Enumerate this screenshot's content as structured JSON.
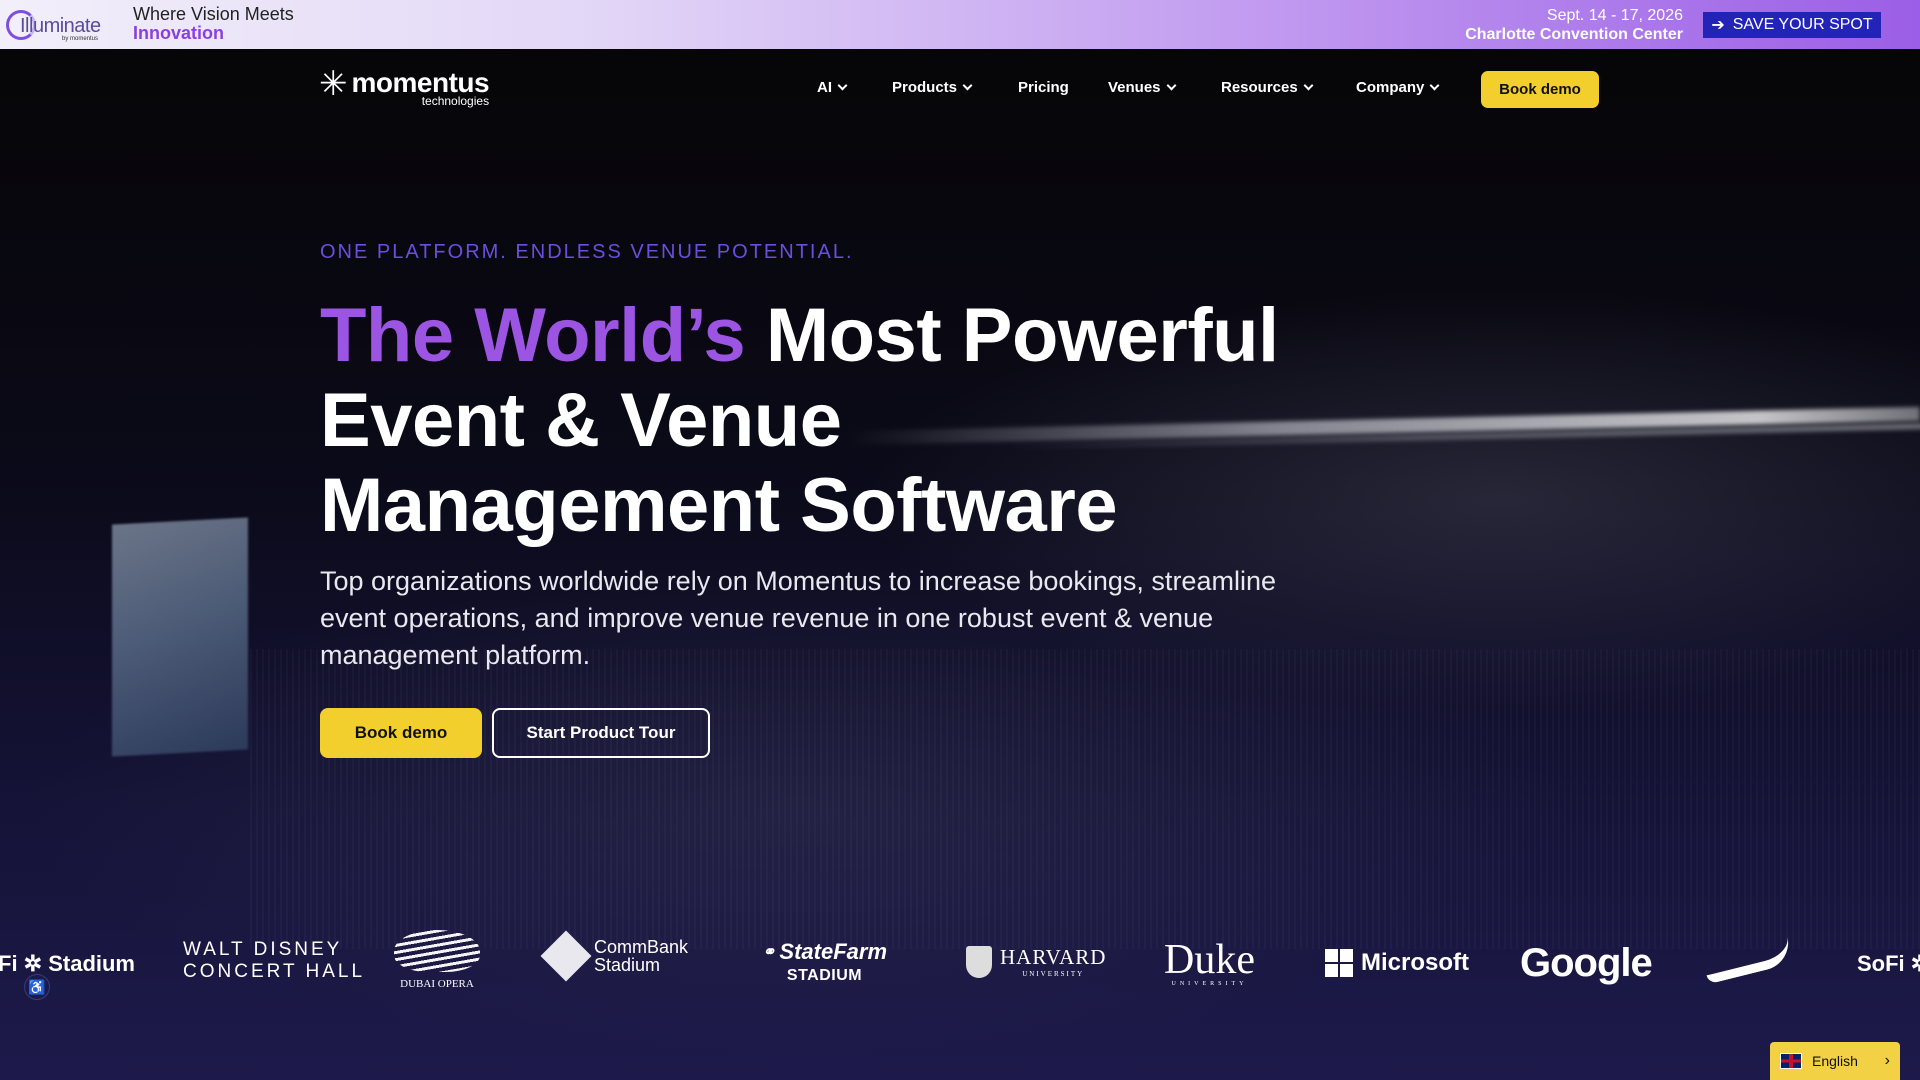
{
  "banner": {
    "logo_word": "Illuminate",
    "logo_by": "by momentus",
    "tagline_line1": "Where Vision Meets",
    "tagline_line2": "Innovation",
    "event_date": "Sept. 14 - 17, 2026",
    "event_venue": "Charlotte Convention Center",
    "cta_icon": "arrow-right-icon",
    "cta_label": "SAVE YOUR SPOT"
  },
  "nav": {
    "logo_name": "momentus",
    "logo_sub": "technologies",
    "items": [
      {
        "label": "AI",
        "dropdown": true
      },
      {
        "label": "Products",
        "dropdown": true
      },
      {
        "label": "Pricing",
        "dropdown": false
      },
      {
        "label": "Venues",
        "dropdown": true
      },
      {
        "label": "Resources",
        "dropdown": true
      },
      {
        "label": "Company",
        "dropdown": true
      }
    ],
    "cta_label": "Book demo"
  },
  "hero": {
    "eyebrow": "ONE PLATFORM. ENDLESS VENUE POTENTIAL.",
    "headline_accent": "The World’s",
    "headline_rest_line1": "Most Powerful",
    "headline_line2": "Event & Venue",
    "headline_line3": "Management Software",
    "subhead": "Top organizations worldwide rely on Momentus to increase bookings, streamline event operations, and improve venue revenue in one robust event & venue management platform.",
    "primary_cta": "Book demo",
    "secondary_cta": "Start Product Tour"
  },
  "clients": {
    "sofi_left": "Fi ✲ Stadium",
    "disney_line1": "WALT DISNEY",
    "disney_line2": "CONCERT HALL",
    "dubai": "DUBAI OPERA",
    "commbank_line1": "CommBank",
    "commbank_line2": "Stadium",
    "statefarm_line1": "StateFarm",
    "statefarm_line2": "STADIUM",
    "harvard_line1": "HARVARD",
    "harvard_line2": "UNIVERSITY",
    "duke_line1": "Duke",
    "duke_line2": "UNIVERSITY",
    "microsoft": "Microsoft",
    "google": "Google",
    "sofi_right": "SoFi ✲"
  },
  "widgets": {
    "accessibility_icon": "accessibility-icon",
    "language": "English"
  },
  "colors": {
    "accent_purple": "#9c55e2",
    "cta_yellow": "#f3cf2e",
    "banner_button": "#2323b8"
  }
}
